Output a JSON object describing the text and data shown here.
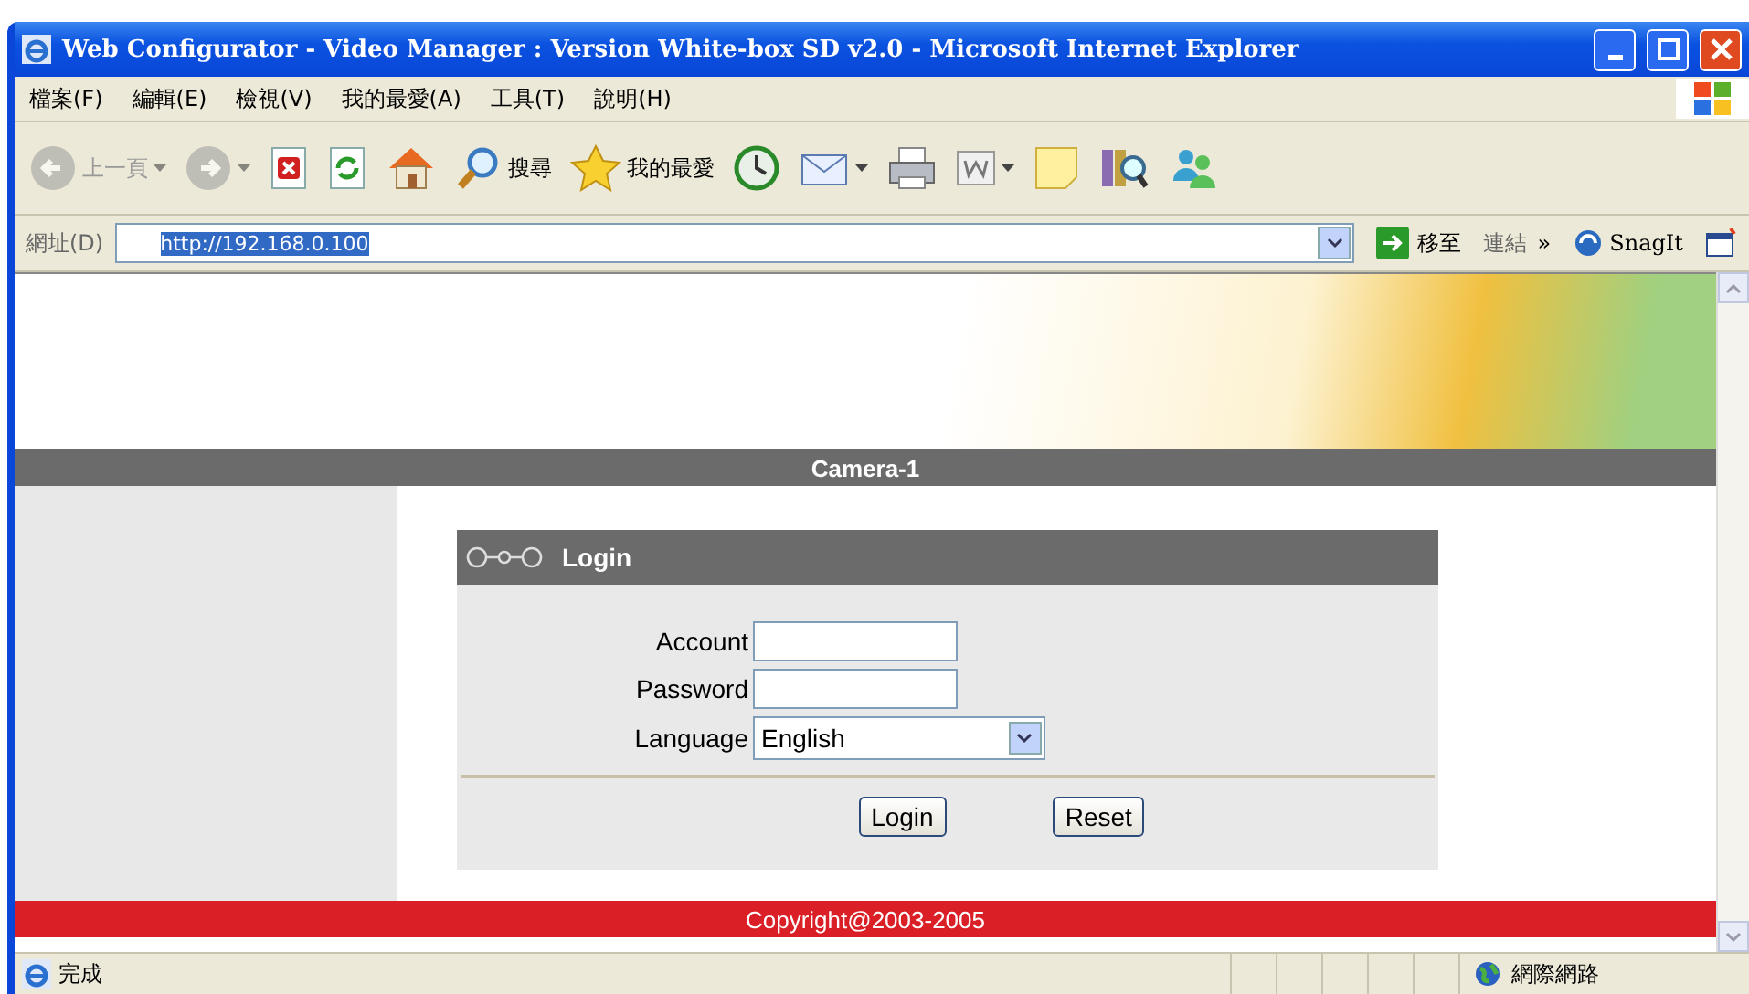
{
  "window": {
    "title": "Web Configurator - Video Manager : Version White-box SD v2.0 - Microsoft Internet Explorer"
  },
  "menu": [
    "檔案(F)",
    "編輯(E)",
    "檢視(V)",
    "我的最愛(A)",
    "工具(T)",
    "說明(H)"
  ],
  "toolbar": [
    {
      "kind": "back",
      "label": "上一頁",
      "disabled": true,
      "dropdown": true
    },
    {
      "kind": "forward",
      "disabled": true,
      "dropdown": true
    },
    {
      "kind": "stop",
      "disabled": false,
      "dropdown": false
    },
    {
      "kind": "refresh",
      "disabled": false,
      "dropdown": false
    },
    {
      "kind": "home",
      "disabled": false,
      "dropdown": false
    },
    {
      "kind": "search",
      "label": "搜尋",
      "disabled": false,
      "dropdown": false
    },
    {
      "kind": "favorites",
      "label": "我的最愛",
      "disabled": false,
      "dropdown": false
    },
    {
      "kind": "history",
      "disabled": false,
      "dropdown": false
    },
    {
      "kind": "mail",
      "disabled": false,
      "dropdown": true
    },
    {
      "kind": "print",
      "disabled": false,
      "dropdown": false
    },
    {
      "kind": "edit",
      "disabled": false,
      "dropdown": true
    },
    {
      "kind": "note",
      "disabled": false,
      "dropdown": false
    },
    {
      "kind": "research",
      "disabled": false,
      "dropdown": false
    },
    {
      "kind": "messenger",
      "disabled": false,
      "dropdown": false
    }
  ],
  "address_bar": {
    "label": "網址(D)",
    "value": "http://192.168.0.100",
    "go": "移至",
    "links": "連結",
    "more": "»",
    "snagit": "SnagIt"
  },
  "page": {
    "camera_title": "Camera-1",
    "login": {
      "title": "Login",
      "fields": [
        {
          "kind": "text",
          "label": "Account"
        },
        {
          "kind": "password",
          "label": "Password"
        },
        {
          "kind": "select",
          "label": "Language",
          "value": "English"
        }
      ],
      "buttons": [
        "Login",
        "Reset"
      ]
    },
    "copyright": "Copyright@2003-2005"
  },
  "status_bar": {
    "text": "完成",
    "zone": "網際網路"
  }
}
